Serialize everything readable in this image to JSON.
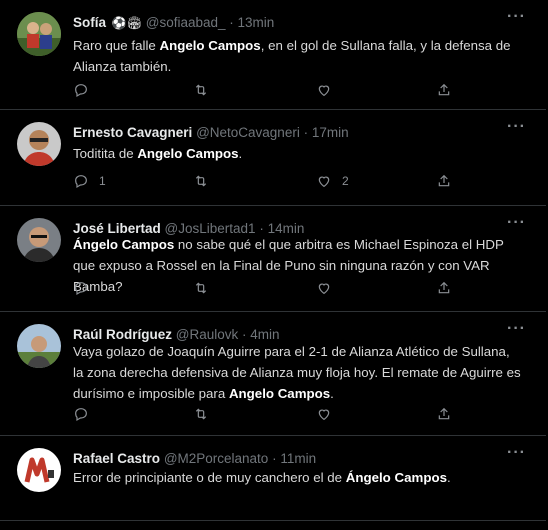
{
  "tweets": [
    {
      "name": "Sofía",
      "emojis": "⚽🏟",
      "handle": "@sofiaabad_",
      "time": "13min",
      "text_before": "Raro que falle ",
      "text_bold": "Angelo Campos",
      "text_after": ", en el gol de Sullana falla, y la defensa de Alianza también.",
      "reply_count": "",
      "like_count": ""
    },
    {
      "name": "Ernesto Cavagneri",
      "handle": "@NetoCavagneri",
      "time": "17min",
      "text_before": "Toditita de ",
      "text_bold": "Angelo Campos",
      "text_after": ".",
      "reply_count": "1",
      "like_count": "2"
    },
    {
      "name": "José Libertad",
      "handle": "@JosLibertad1",
      "time": "14min",
      "text_before": "",
      "text_bold": "Ángelo Campos",
      "text_after": " no sabe qué el que arbitra es Michael Espinoza el HDP que expuso a Rossel en la Final de Puno sin ninguna razón y con VAR Bamba?",
      "reply_count": "",
      "like_count": ""
    },
    {
      "name": "Raúl Rodríguez",
      "handle": "@Raulovk",
      "time": "4min",
      "text_before": "Vaya golazo de Joaquín Aguirre para el 2-1 de Alianza Atlético de Sullana, la zona derecha defensiva de Alianza muy floja hoy. El remate de Aguirre es durísimo e imposible para ",
      "text_bold": "Angelo Campos",
      "text_after": ".",
      "reply_count": "",
      "like_count": ""
    },
    {
      "name": "Rafael Castro",
      "handle": "@M2Porcelanato",
      "time": "11min",
      "text_before": "Error de principiante o de muy canchero el de ",
      "text_bold": "Ángelo Campos",
      "text_after": ".",
      "reply_count": "",
      "like_count": ""
    }
  ],
  "separator": "·",
  "more_label": "···",
  "colors": {
    "background": "#000000",
    "muted": "#71767b",
    "border": "#2f3336"
  },
  "icons": [
    "reply-icon",
    "retweet-icon",
    "like-icon",
    "share-icon",
    "more-icon"
  ]
}
